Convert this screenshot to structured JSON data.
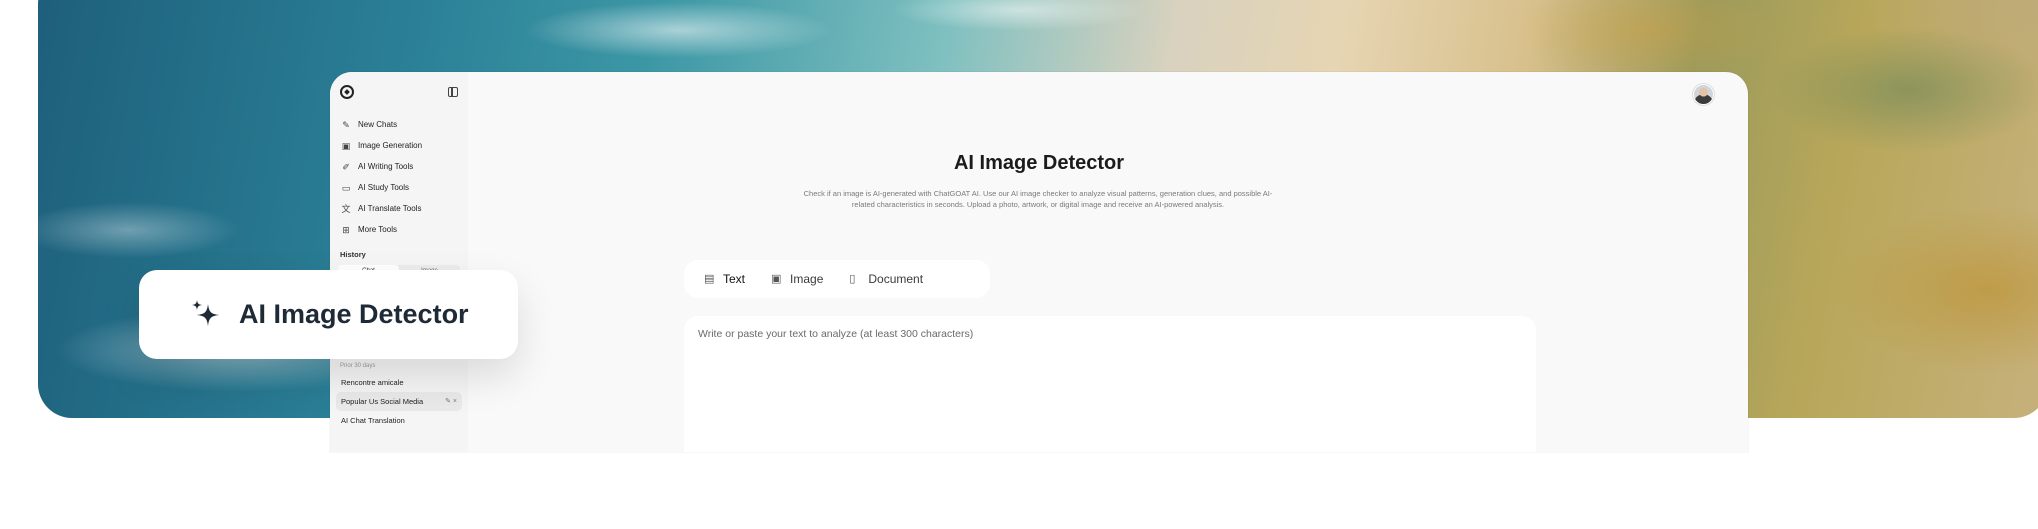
{
  "sidebar": {
    "nav_items": [
      {
        "label": "New Chats",
        "icon": "edit-icon"
      },
      {
        "label": "Image Generation",
        "icon": "image-icon"
      },
      {
        "label": "AI Writing Tools",
        "icon": "pen-icon"
      },
      {
        "label": "AI Study Tools",
        "icon": "book-icon"
      },
      {
        "label": "AI Translate Tools",
        "icon": "translate-icon"
      },
      {
        "label": "More Tools",
        "icon": "grid-icon"
      }
    ],
    "history_label": "History",
    "history_tabs": [
      "Chat",
      "Image"
    ],
    "history_group": "Prior 30 days",
    "history_items": [
      {
        "label": "Rencontre amicale"
      },
      {
        "label": "Popular Us Social Media"
      },
      {
        "label": "AI Chat Translation"
      }
    ]
  },
  "main": {
    "title": "AI Image Detector",
    "description": "Check if an image is AI-generated with ChatGOAT AI. Use our AI image checker to analyze visual patterns, generation clues, and possible AI-related characteristics in seconds. Upload a photo, artwork, or digital image and receive an AI-powered analysis.",
    "tabs": [
      {
        "label": "Text",
        "icon": "document-text-icon",
        "active": true
      },
      {
        "label": "Image",
        "icon": "image-icon",
        "active": false
      },
      {
        "label": "Document",
        "icon": "document-icon",
        "active": false
      }
    ],
    "input_placeholder": "Write or paste your text to analyze (at least 300 characters)"
  },
  "badge": {
    "label": "AI Image Detector",
    "icon": "sparkles-icon"
  },
  "colors": {
    "page_bg": "#ffffff",
    "app_bg": "#f9f9f9",
    "sidebar_bg": "#f5f5f5",
    "title_text": "#1b1b1b",
    "badge_text": "#1f2a37"
  }
}
